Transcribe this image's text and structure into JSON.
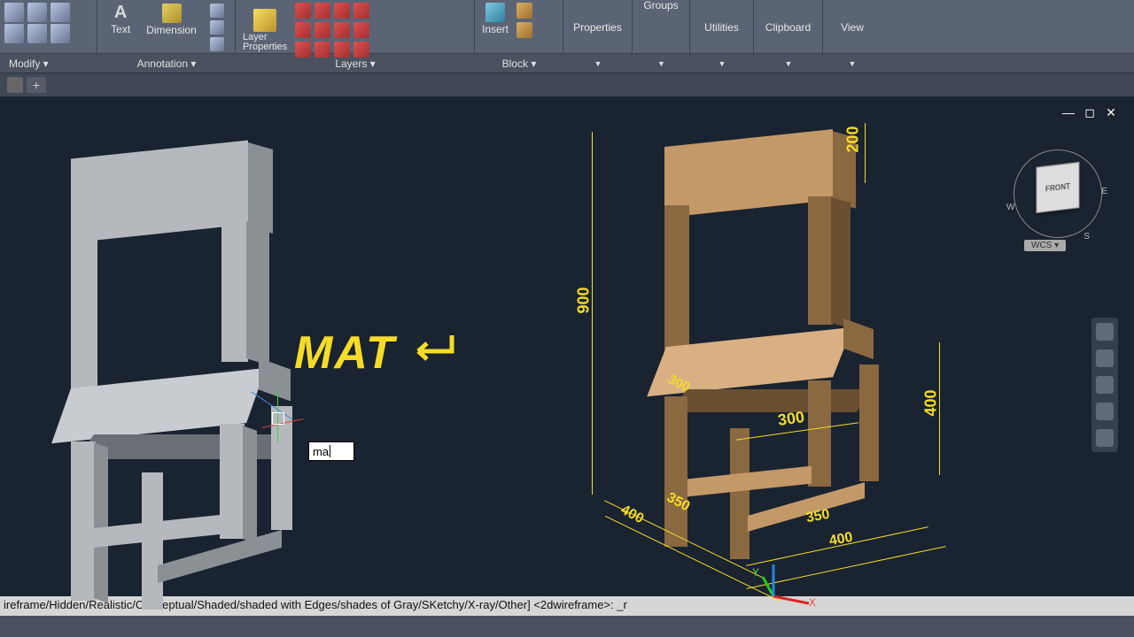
{
  "ribbon": {
    "modify_panel": "Modify ▾",
    "text_label": "Text",
    "dimension_label": "Dimension",
    "annotation_panel": "Annotation ▾",
    "layerprops_label": "Layer\nProperties",
    "layers_panel": "Layers ▾",
    "insert_label": "Insert",
    "block_panel": "Block ▾",
    "properties_label": "Properties",
    "groups_label": "Groups",
    "utilities_label": "Utilities",
    "clipboard_label": "Clipboard",
    "view_label": "View"
  },
  "tabbar": {
    "plus": "+"
  },
  "canvas": {
    "mat_text": "MAT",
    "input_value": "ma",
    "wcs_label": "WCS",
    "viewcube_face": "FRONT",
    "compass": {
      "n": "",
      "e": "E",
      "s": "S",
      "w": "W"
    }
  },
  "dimensions": {
    "d900": "900",
    "d200": "200",
    "d300a": "300",
    "d300b": "300",
    "d400a": "400",
    "d350a": "350",
    "d350b": "350",
    "d400b": "400",
    "d400c": "400"
  },
  "ucs": {
    "x": "X",
    "y": "Y"
  },
  "cmdline": "ireframe/Hidden/Realistic/Conceptual/Shaded/shaded with Edges/shades of Gray/SKetchy/X-ray/Other] <2dwireframe>: _r"
}
